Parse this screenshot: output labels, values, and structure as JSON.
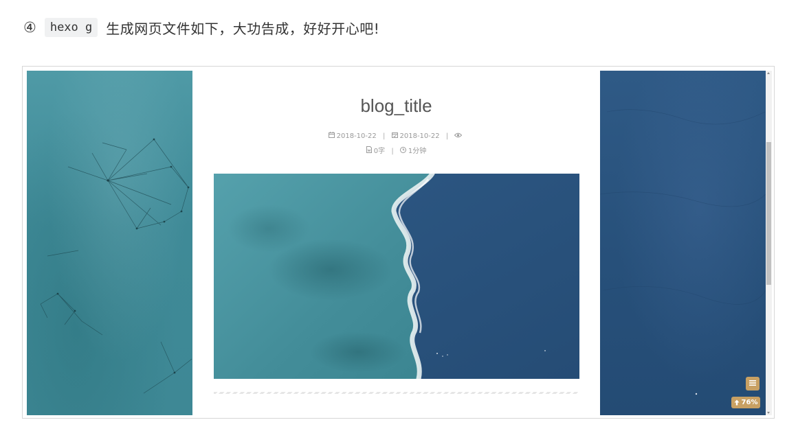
{
  "instruction": {
    "step_number": "④",
    "command": "hexo g",
    "text": "生成网页文件如下，大功告成，好好开心吧!"
  },
  "preview": {
    "post_title": "blog_title",
    "meta_line1": {
      "created_date": "2018-10-22",
      "sep1": "|",
      "updated_date": "2018-10-22",
      "sep2": "|"
    },
    "meta_line2": {
      "word_count": "0字",
      "sep": "|",
      "read_time": "1分钟"
    },
    "icons": {
      "created": "calendar-icon",
      "updated": "calendar-check-icon",
      "views": "eye-icon",
      "words": "file-word-icon",
      "time": "clock-icon",
      "toc": "list-icon",
      "back_to_top": "arrow-up-icon"
    },
    "back_to_top_label": "76%",
    "scroll_percent": 76,
    "colors": {
      "accent": "#c8a063",
      "sea_light": "#4f9aa6",
      "sea_deep": "#27507a"
    }
  }
}
